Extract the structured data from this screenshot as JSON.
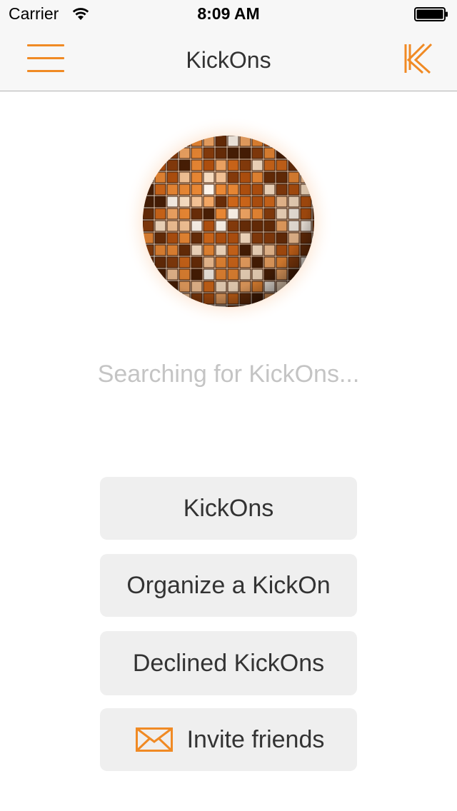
{
  "status_bar": {
    "carrier": "Carrier",
    "time": "8:09 AM"
  },
  "nav": {
    "title": "KickOns",
    "menu_icon": "hamburger-menu-icon",
    "logo_icon": "kickons-logo-icon"
  },
  "hero": {
    "image": "disco-ball-image",
    "status_text": "Searching for KickOns..."
  },
  "buttons": {
    "kickons": "KickOns",
    "organize": "Organize a KickOn",
    "declined": "Declined KickOns",
    "invite": "Invite friends"
  },
  "colors": {
    "accent": "#f08a24",
    "button_bg": "#efefef",
    "placeholder_text": "#c4c4c4"
  }
}
